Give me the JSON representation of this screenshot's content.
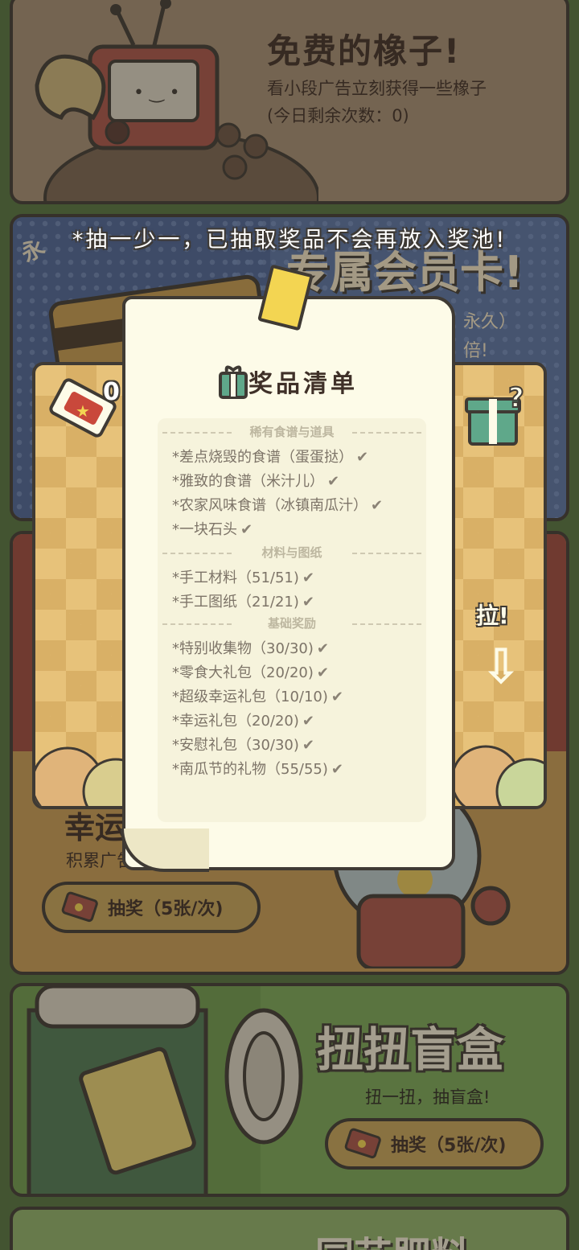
{
  "free_acorns": {
    "title": "免费的橡子!",
    "desc": "看小段广告立刻获得一些橡子",
    "remaining": "(今日剩余次数：0)"
  },
  "vip_card": {
    "badge": "永",
    "title": "专属会员卡!",
    "line1": "永久）",
    "line2": "倍!"
  },
  "lucky_draw": {
    "title": "幸运",
    "desc": "积累广告点",
    "button_label": "抽奖（5张/次)",
    "counter": "0",
    "pull_label": "拉!"
  },
  "blind_box": {
    "title": "扭扭盲盒",
    "subtitle": "扭一扭，抽盲盒!",
    "button_label": "抽奖（5张/次)"
  },
  "fertilizer": {
    "title": "园艺肥料"
  },
  "notice": "*抽一少一，已抽取奖品不会再放入奖池!",
  "prize_list": {
    "title": "奖品清单",
    "sections": [
      {
        "header": "稀有食谱与道具",
        "items": [
          "*差点烧毁的食谱（蛋蛋挞）",
          "*雅致的食谱（米汁儿）",
          "*农家风味食谱（冰镇南瓜汁）",
          "*一块石头"
        ]
      },
      {
        "header": "材料与图纸",
        "items": [
          "*手工材料（51/51)",
          "*手工图纸（21/21)"
        ]
      },
      {
        "header": "基础奖励",
        "items": [
          "*特别收集物（30/30)",
          "*零食大礼包（20/20)",
          "*超级幸运礼包（10/10)",
          "*幸运礼包（20/20)",
          "*安慰礼包（30/30)",
          "*南瓜节的礼物（55/55)"
        ]
      }
    ],
    "check_symbol": "✔"
  },
  "icons": {
    "gift": "gift-icon",
    "mystery_gift": "mystery-gift-icon",
    "ticket": "ticket-icon",
    "tape": "tape-icon",
    "arrow_down": "arrow-down-icon"
  },
  "colors": {
    "outline": "#3f3a34",
    "paper": "#fdfbe8",
    "gift_green": "#5fa88a"
  }
}
